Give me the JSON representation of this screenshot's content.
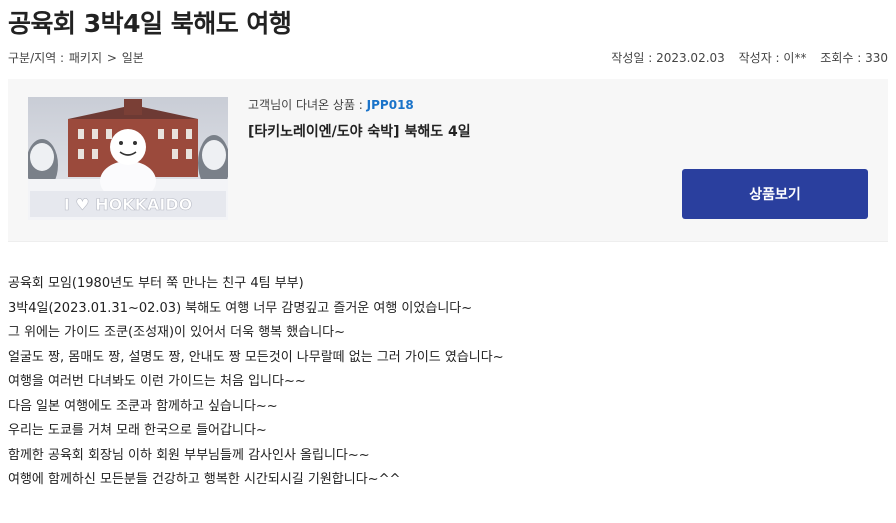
{
  "post": {
    "title": "공육회 3박4일 북해도 여행",
    "breadcrumb": {
      "category_label": "구분/지역 : ",
      "category": "패키지",
      "separator": " > ",
      "region": "일본"
    },
    "date_label": "작성일 : ",
    "date": "2023.02.03",
    "author_label": "작성자 : ",
    "author": "이**",
    "views_label": "조회수 : ",
    "views": "330"
  },
  "product": {
    "code_label": "고객님이 다녀온 상품 : ",
    "code": "JPP018",
    "name": "[타키노레이엔/도야 숙박] 북해도 4일",
    "button_label": "상품보기",
    "thumbnail_text": "I ♥ HOKKAIDO"
  },
  "body": {
    "lines": [
      "공육회 모임(1980년도 부터 쭉 만나는 친구 4팀 부부)",
      "3박4일(2023.01.31~02.03) 북해도 여행 너무 감명깊고 즐거운 여행 이었습니다~",
      "그 위에는 가이드 조쿤(조성재)이 있어서 더욱 행복 했습니다~",
      "얼굴도 짱, 몸매도 짱, 설명도 짱, 안내도 짱  모든것이 나무랄떼 없는 그러 가이드 였습니다~",
      "여행을 여러번 다녀봐도 이런 가이드는 처음 입니다~~",
      "다음 일본 여행에도 조쿤과 함께하고 싶습니다~~",
      "우리는 도쿄를 거쳐 모래 한국으로 들어갑니다~",
      "함께한 공육회 회장님 이하 회원 부부님들께 감사인사 올립니다~~",
      "여행에 함께하신 모든분들 건강하고 행복한 시간되시길 기원합니다~^^"
    ]
  },
  "colors": {
    "accent_button": "#2a3f9e",
    "product_code": "#1a73c9",
    "box_background": "#f7f7f7"
  }
}
